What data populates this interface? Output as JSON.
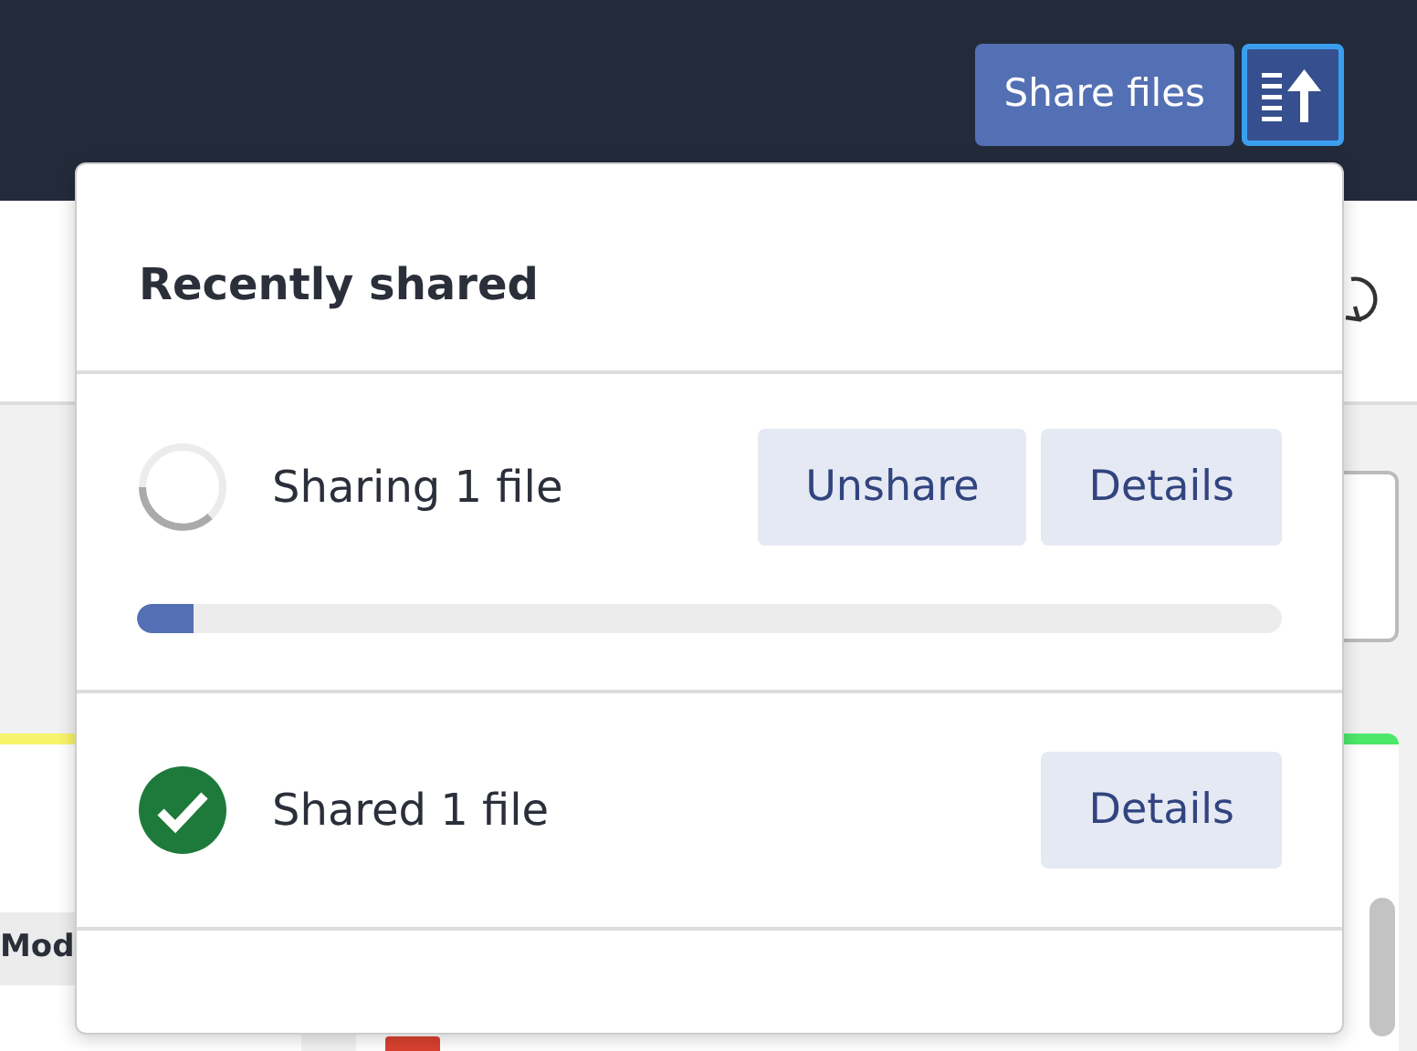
{
  "header": {
    "share_button": "Share files",
    "transfers_button": {
      "selected": true
    }
  },
  "background": {
    "left_column_heading": "Mod"
  },
  "popover": {
    "title": "Recently shared",
    "items": [
      {
        "kind": "in_progress",
        "label": "Sharing 1 file",
        "buttons": [
          "Unshare",
          "Details"
        ],
        "level": 0.05
      },
      {
        "kind": "done",
        "label": "Shared 1 file",
        "buttons": [
          "Details"
        ]
      }
    ]
  }
}
